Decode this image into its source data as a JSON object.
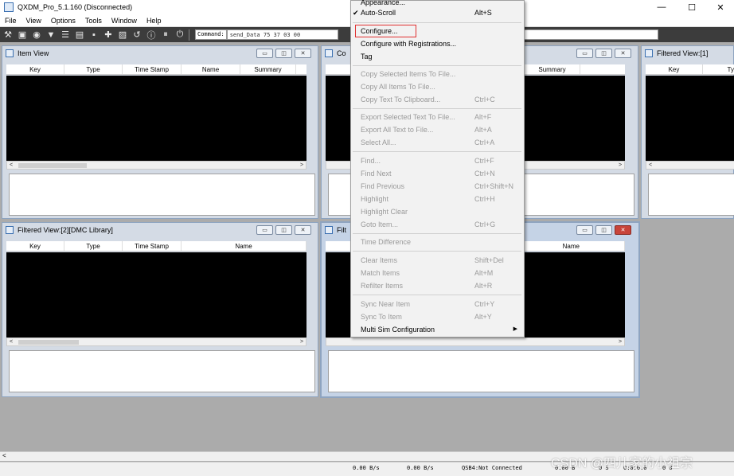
{
  "window": {
    "title": "QXDM_Pro_5.1.160 (Disconnected)",
    "minimize": "—",
    "maximize": "☐",
    "close": "✕"
  },
  "menubar": [
    "File",
    "View",
    "Options",
    "Tools",
    "Window",
    "Help"
  ],
  "toolbar": {
    "command_label": "Command:",
    "command_value": "send_Data 75 37 03 00"
  },
  "windows": {
    "item_view": {
      "title": "Item View",
      "columns": [
        "Key",
        "Type",
        "Time Stamp",
        "Name",
        "Summary"
      ]
    },
    "common": {
      "title": "Co",
      "columns": [
        "ame",
        "Summary"
      ]
    },
    "filtered1": {
      "title": "Filtered View:[1]",
      "columns": [
        "Key",
        "Ty"
      ]
    },
    "filtered2": {
      "title": "Filtered View:[2][DMC Library]",
      "columns": [
        "Key",
        "Type",
        "Time Stamp",
        "Name"
      ]
    },
    "filtered3": {
      "title": "Filt",
      "columns": [
        "Name"
      ]
    }
  },
  "menu": {
    "items": [
      {
        "label": "Appearance...",
        "shortcut": "",
        "disabled": false
      },
      {
        "label": "Auto-Scroll",
        "shortcut": "Alt+S",
        "disabled": false,
        "checked": true
      },
      {
        "label": "Configure...",
        "shortcut": "",
        "disabled": false
      },
      {
        "label": "Configure with Registrations...",
        "shortcut": "",
        "disabled": false
      },
      {
        "label": "Tag",
        "shortcut": "",
        "disabled": false
      },
      {
        "label": "Copy Selected Items To File...",
        "shortcut": "",
        "disabled": true
      },
      {
        "label": "Copy All Items To File...",
        "shortcut": "",
        "disabled": true
      },
      {
        "label": "Copy Text To Clipboard...",
        "shortcut": "Ctrl+C",
        "disabled": true
      },
      {
        "label": "Export Selected Text To File...",
        "shortcut": "Alt+F",
        "disabled": true
      },
      {
        "label": "Export All Text to File...",
        "shortcut": "Alt+A",
        "disabled": true
      },
      {
        "label": "Select All...",
        "shortcut": "Ctrl+A",
        "disabled": true
      },
      {
        "label": "Find...",
        "shortcut": "Ctrl+F",
        "disabled": true
      },
      {
        "label": "Find Next",
        "shortcut": "Ctrl+N",
        "disabled": true
      },
      {
        "label": "Find Previous",
        "shortcut": "Ctrl+Shift+N",
        "disabled": true
      },
      {
        "label": "Highlight",
        "shortcut": "Ctrl+H",
        "disabled": true
      },
      {
        "label": "Highlight Clear",
        "shortcut": "",
        "disabled": true
      },
      {
        "label": "Goto Item...",
        "shortcut": "Ctrl+G",
        "disabled": true
      },
      {
        "label": "Time Difference",
        "shortcut": "",
        "disabled": true
      },
      {
        "label": "Clear Items",
        "shortcut": "Shift+Del",
        "disabled": true
      },
      {
        "label": "Match Items",
        "shortcut": "Alt+M",
        "disabled": true
      },
      {
        "label": "Refilter Items",
        "shortcut": "Alt+R",
        "disabled": true
      },
      {
        "label": "Sync Near Item",
        "shortcut": "Ctrl+Y",
        "disabled": true
      },
      {
        "label": "Sync To Item",
        "shortcut": "Alt+Y",
        "disabled": true
      },
      {
        "label": "Multi Sim Configuration",
        "shortcut": "",
        "disabled": false,
        "submenu": true
      }
    ]
  },
  "status": {
    "rate1": "0.00 B/s",
    "rate2": "0.00 B/s",
    "conn": "QSB4:Not Connected",
    "bytes": "0.00 B",
    "extra": "0 S",
    "time": "0:0:0.0",
    "nums": "0    0"
  },
  "watermark": "CSDN @四儿家的小祖宗",
  "colors": {
    "highlight_box": "#e03030",
    "toolbar_bg": "#3c3c3c"
  }
}
